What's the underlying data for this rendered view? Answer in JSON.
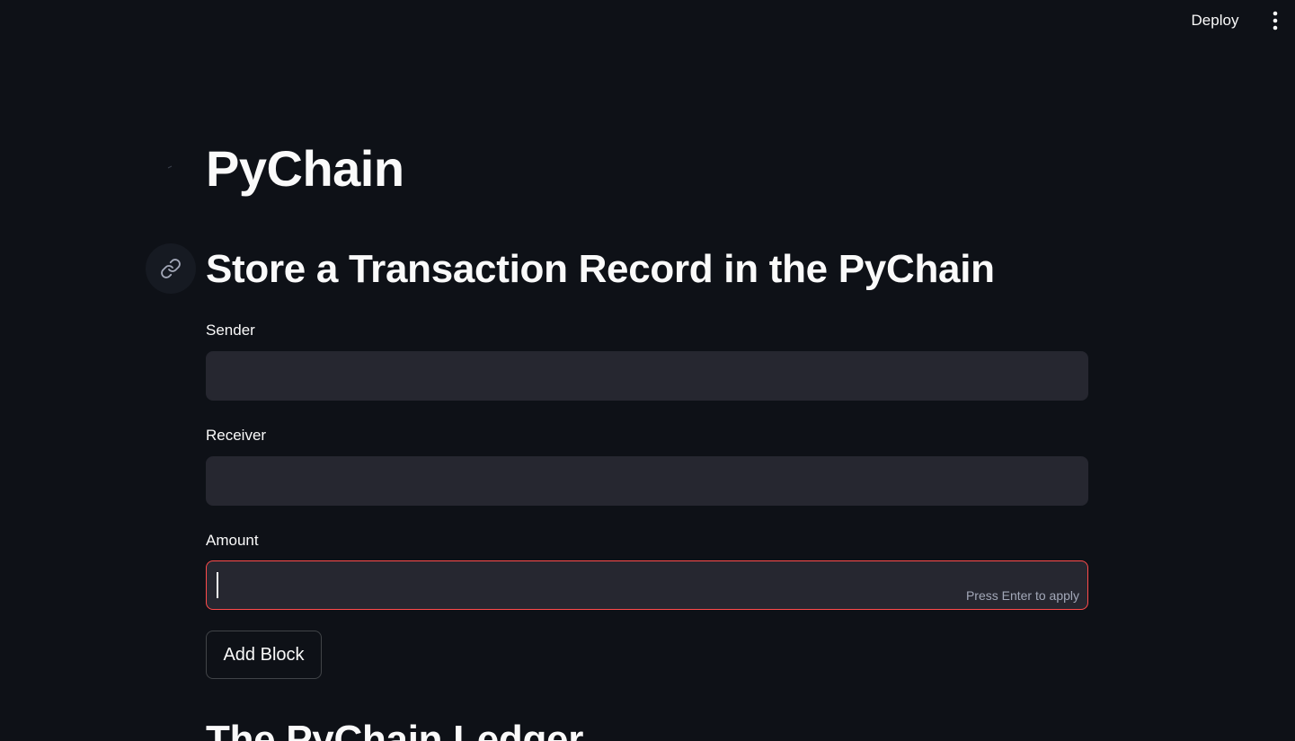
{
  "header": {
    "deploy_label": "Deploy",
    "menu_icon": "vertical-ellipsis-icon"
  },
  "main": {
    "title": "PyChain",
    "subheading": "Store a Transaction Record in the PyChain",
    "anchor_icon": "link-icon",
    "form": {
      "sender": {
        "label": "Sender",
        "value": ""
      },
      "receiver": {
        "label": "Receiver",
        "value": ""
      },
      "amount": {
        "label": "Amount",
        "value": "",
        "hint": "Press Enter to apply"
      }
    },
    "add_block_label": "Add Block",
    "ledger_heading": "The PyChain Ledger"
  },
  "colors": {
    "background": "#0e1117",
    "input_background": "#262730",
    "focus_border": "#ff4b4b",
    "text": "#fafafa",
    "hint_text": "#a3a8b8"
  }
}
